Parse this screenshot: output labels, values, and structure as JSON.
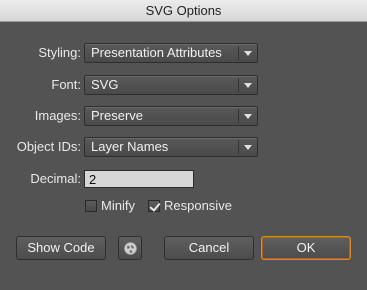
{
  "window": {
    "title": "SVG Options"
  },
  "fields": {
    "styling": {
      "label": "Styling:",
      "value": "Presentation Attributes"
    },
    "font": {
      "label": "Font:",
      "value": "SVG"
    },
    "images": {
      "label": "Images:",
      "value": "Preserve"
    },
    "object_ids": {
      "label": "Object IDs:",
      "value": "Layer Names"
    },
    "decimal": {
      "label": "Decimal:",
      "value": "2"
    }
  },
  "checkboxes": {
    "minify": {
      "label": "Minify",
      "checked": false
    },
    "responsive": {
      "label": "Responsive",
      "checked": true
    }
  },
  "buttons": {
    "show_code": "Show Code",
    "cancel": "Cancel",
    "ok": "OK"
  },
  "icons": {
    "globe": "globe-icon"
  },
  "colors": {
    "background": "#535353",
    "ok_border": "#d28a28"
  }
}
